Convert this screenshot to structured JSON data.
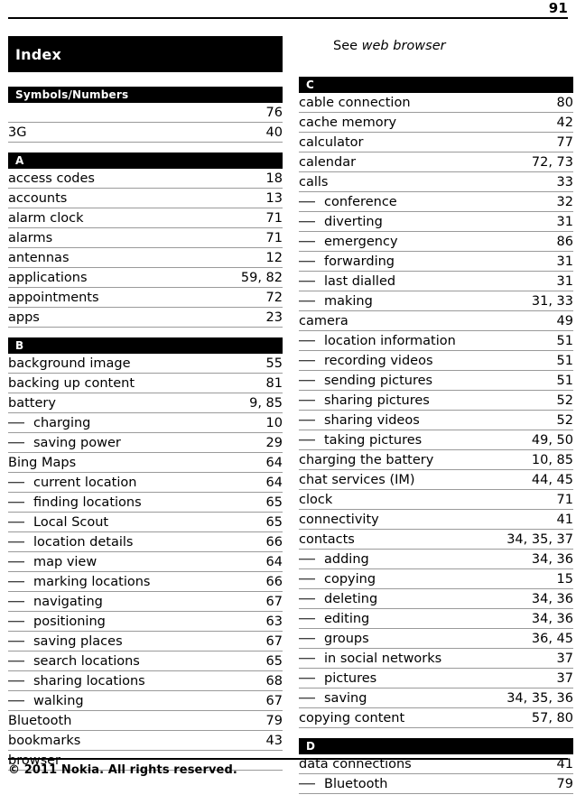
{
  "page": {
    "number": "91",
    "footer_text": "© 2011 Nokia. All rights reserved."
  },
  "title_bar": {
    "label": "Index"
  },
  "note": {
    "prefix": "See ",
    "italic": "web browser"
  },
  "left_column": {
    "sections": [
      {
        "letter": "Symbols/Numbers",
        "entries": [
          {
            "label": "",
            "pages": "76",
            "sub": false
          },
          {
            "label": "3G",
            "pages": "40",
            "sub": false
          }
        ]
      },
      {
        "letter": "A",
        "entries": [
          {
            "label": "access codes",
            "pages": "18",
            "sub": false
          },
          {
            "label": "accounts",
            "pages": "13",
            "sub": false
          },
          {
            "label": "alarm clock",
            "pages": "71",
            "sub": false
          },
          {
            "label": "alarms",
            "pages": "71",
            "sub": false
          },
          {
            "label": "antennas",
            "pages": "12",
            "sub": false
          },
          {
            "label": "applications",
            "pages": "59, 82",
            "sub": false
          },
          {
            "label": "appointments",
            "pages": "72",
            "sub": false
          },
          {
            "label": "apps",
            "pages": "23",
            "sub": false
          }
        ]
      },
      {
        "letter": "B",
        "entries": [
          {
            "label": "background image",
            "pages": "55",
            "sub": false
          },
          {
            "label": "backing up content",
            "pages": "81",
            "sub": false
          },
          {
            "label": "battery",
            "pages": "9, 85",
            "sub": false
          },
          {
            "label": "charging",
            "pages": "10",
            "sub": true
          },
          {
            "label": "saving power",
            "pages": "29",
            "sub": true
          },
          {
            "label": "Bing Maps",
            "pages": "64",
            "sub": false
          },
          {
            "label": "current location",
            "pages": "64",
            "sub": true
          },
          {
            "label": "finding locations",
            "pages": "65",
            "sub": true
          },
          {
            "label": "Local Scout",
            "pages": "65",
            "sub": true
          },
          {
            "label": "location details",
            "pages": "66",
            "sub": true
          },
          {
            "label": "map view",
            "pages": "64",
            "sub": true
          },
          {
            "label": "marking locations",
            "pages": "66",
            "sub": true
          },
          {
            "label": "navigating",
            "pages": "67",
            "sub": true
          },
          {
            "label": "positioning",
            "pages": "63",
            "sub": true
          },
          {
            "label": "saving places",
            "pages": "67",
            "sub": true
          },
          {
            "label": "search locations",
            "pages": "65",
            "sub": true
          },
          {
            "label": "sharing locations",
            "pages": "68",
            "sub": true
          },
          {
            "label": "walking",
            "pages": "67",
            "sub": true
          },
          {
            "label": "Bluetooth",
            "pages": "79",
            "sub": false
          },
          {
            "label": "bookmarks",
            "pages": "43",
            "sub": false
          },
          {
            "label": "browser",
            "pages": "",
            "sub": false
          }
        ]
      }
    ]
  },
  "right_column": {
    "sections": [
      {
        "letter": "C",
        "entries": [
          {
            "label": "cable connection",
            "pages": "80",
            "sub": false
          },
          {
            "label": "cache memory",
            "pages": "42",
            "sub": false
          },
          {
            "label": "calculator",
            "pages": "77",
            "sub": false
          },
          {
            "label": "calendar",
            "pages": "72, 73",
            "sub": false
          },
          {
            "label": "calls",
            "pages": "33",
            "sub": false
          },
          {
            "label": "conference",
            "pages": "32",
            "sub": true
          },
          {
            "label": "diverting",
            "pages": "31",
            "sub": true
          },
          {
            "label": "emergency",
            "pages": "86",
            "sub": true
          },
          {
            "label": "forwarding",
            "pages": "31",
            "sub": true
          },
          {
            "label": "last dialled",
            "pages": "31",
            "sub": true
          },
          {
            "label": "making",
            "pages": "31, 33",
            "sub": true
          },
          {
            "label": "camera",
            "pages": "49",
            "sub": false
          },
          {
            "label": "location information",
            "pages": "51",
            "sub": true
          },
          {
            "label": "recording videos",
            "pages": "51",
            "sub": true
          },
          {
            "label": "sending pictures",
            "pages": "51",
            "sub": true
          },
          {
            "label": "sharing pictures",
            "pages": "52",
            "sub": true
          },
          {
            "label": "sharing videos",
            "pages": "52",
            "sub": true
          },
          {
            "label": "taking pictures",
            "pages": "49, 50",
            "sub": true
          },
          {
            "label": "charging the battery",
            "pages": "10, 85",
            "sub": false
          },
          {
            "label": "chat services (IM)",
            "pages": "44, 45",
            "sub": false
          },
          {
            "label": "clock",
            "pages": "71",
            "sub": false
          },
          {
            "label": "connectivity",
            "pages": "41",
            "sub": false
          },
          {
            "label": "contacts",
            "pages": "34, 35, 37",
            "sub": false
          },
          {
            "label": "adding",
            "pages": "34, 36",
            "sub": true
          },
          {
            "label": "copying",
            "pages": "15",
            "sub": true
          },
          {
            "label": "deleting",
            "pages": "34, 36",
            "sub": true
          },
          {
            "label": "editing",
            "pages": "34, 36",
            "sub": true
          },
          {
            "label": "groups",
            "pages": "36, 45",
            "sub": true
          },
          {
            "label": "in social networks",
            "pages": "37",
            "sub": true
          },
          {
            "label": "pictures",
            "pages": "37",
            "sub": true
          },
          {
            "label": "saving",
            "pages": "34, 35, 36",
            "sub": true
          },
          {
            "label": "copying content",
            "pages": "57, 80",
            "sub": false
          }
        ]
      },
      {
        "letter": "D",
        "entries": [
          {
            "label": "data connections",
            "pages": "41",
            "sub": false
          },
          {
            "label": "Bluetooth",
            "pages": "79",
            "sub": true
          }
        ]
      }
    ]
  }
}
